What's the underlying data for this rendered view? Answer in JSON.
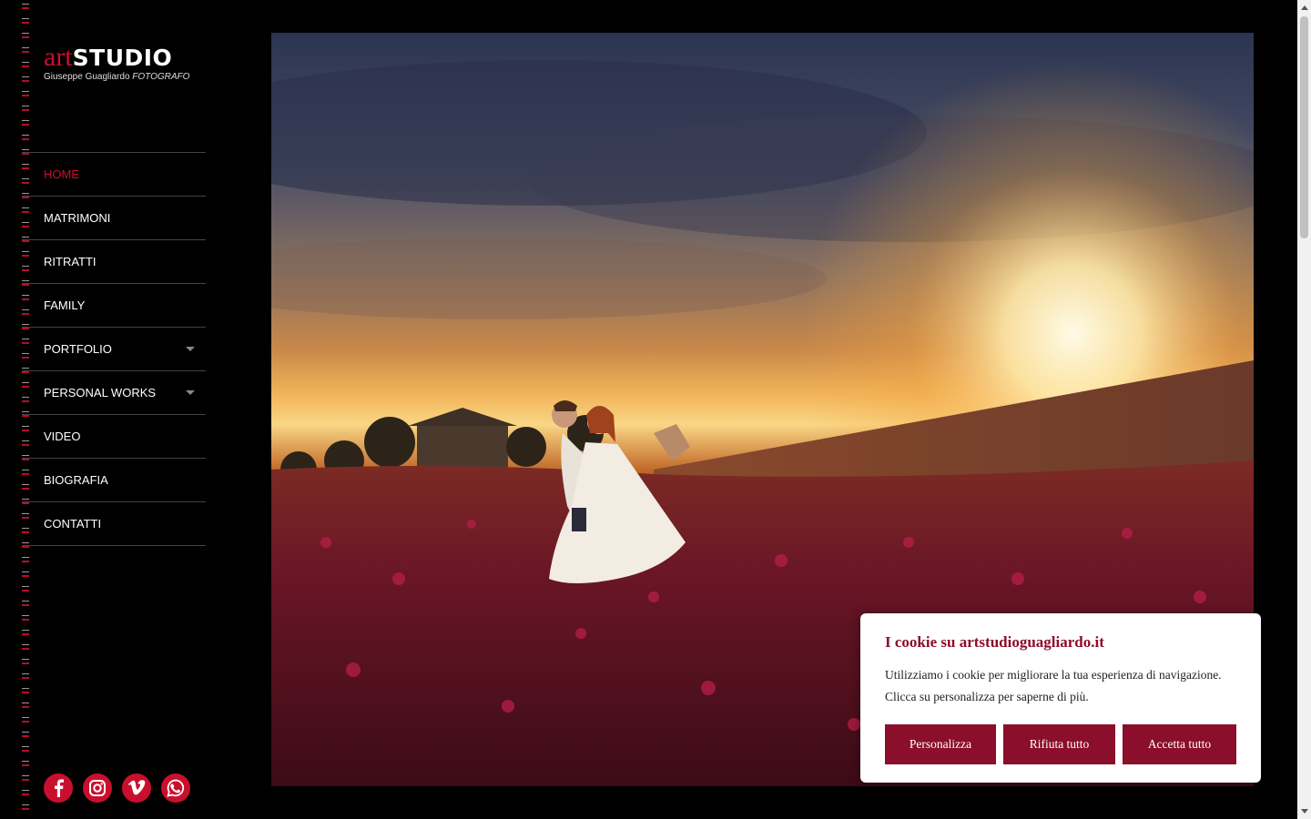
{
  "logo": {
    "art": "art",
    "studio": "STUDIO",
    "sub_name": "Giuseppe Guagliardo",
    "sub_role": "FOTOGRAFO"
  },
  "nav": {
    "items": [
      {
        "label": "HOME",
        "active": true,
        "dropdown": false
      },
      {
        "label": "MATRIMONI",
        "active": false,
        "dropdown": false
      },
      {
        "label": "RITRATTI",
        "active": false,
        "dropdown": false
      },
      {
        "label": "FAMILY",
        "active": false,
        "dropdown": false
      },
      {
        "label": "PORTFOLIO",
        "active": false,
        "dropdown": true
      },
      {
        "label": "PERSONAL WORKS",
        "active": false,
        "dropdown": true
      },
      {
        "label": "VIDEO",
        "active": false,
        "dropdown": false
      },
      {
        "label": "BIOGRAFIA",
        "active": false,
        "dropdown": false
      },
      {
        "label": "CONTATTI",
        "active": false,
        "dropdown": false
      }
    ]
  },
  "social": [
    {
      "name": "facebook-icon"
    },
    {
      "name": "instagram-icon"
    },
    {
      "name": "vimeo-icon"
    },
    {
      "name": "whatsapp-icon"
    }
  ],
  "colors": {
    "accent": "#c8102e",
    "cookie_accent": "#8b0e2a",
    "background": "#000000"
  },
  "cookie": {
    "title": "I cookie su artstudioguagliardo.it",
    "text_line1": "Utilizziamo i cookie per migliorare la tua esperienza di navigazione.",
    "text_line2": "Clicca su personalizza per saperne di più.",
    "btn_customize": "Personalizza",
    "btn_reject": "Rifiuta tutto",
    "btn_accept": "Accetta tutto"
  }
}
